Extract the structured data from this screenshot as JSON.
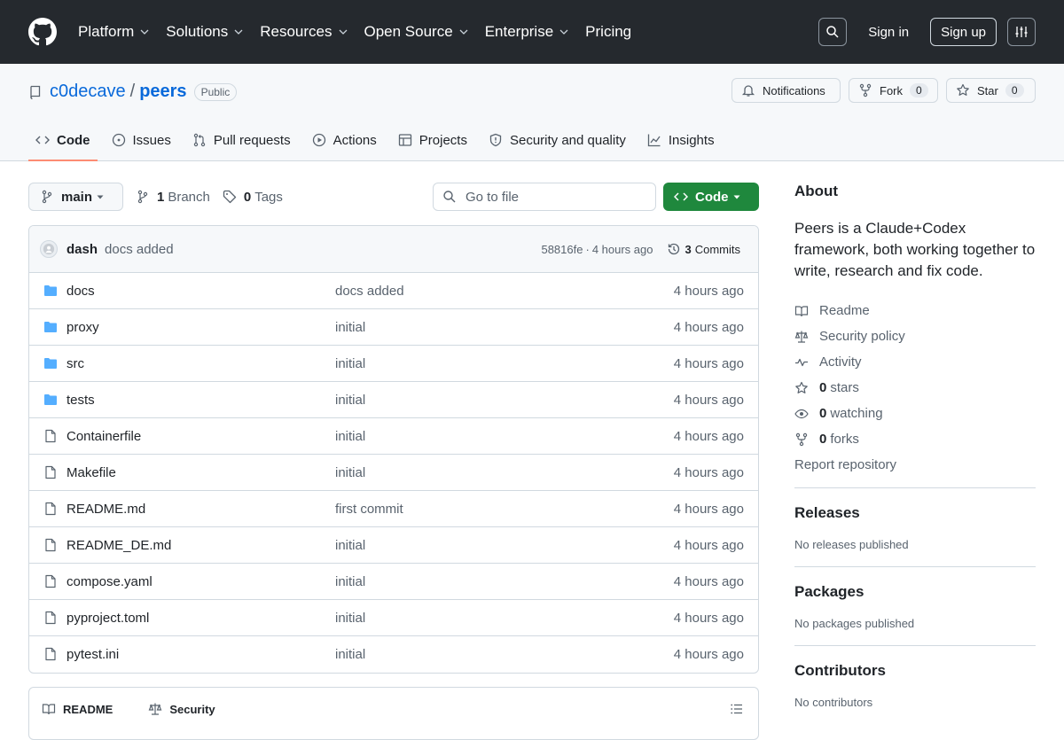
{
  "header": {
    "nav": [
      {
        "label": "Platform",
        "has_menu": true
      },
      {
        "label": "Solutions",
        "has_menu": true
      },
      {
        "label": "Resources",
        "has_menu": true
      },
      {
        "label": "Open Source",
        "has_menu": true
      },
      {
        "label": "Enterprise",
        "has_menu": true
      },
      {
        "label": "Pricing",
        "has_menu": false
      }
    ],
    "signin": "Sign in",
    "signup": "Sign up"
  },
  "repo": {
    "owner": "c0decave",
    "separator": "/",
    "name": "peers",
    "visibility": "Public",
    "notifications_label": "Notifications",
    "fork_label": "Fork",
    "fork_count": "0",
    "star_label": "Star",
    "star_count": "0"
  },
  "tabs": [
    {
      "label": "Code",
      "icon": "code-icon",
      "selected": true
    },
    {
      "label": "Issues",
      "icon": "issue-icon"
    },
    {
      "label": "Pull requests",
      "icon": "pull-request-icon"
    },
    {
      "label": "Actions",
      "icon": "play-icon"
    },
    {
      "label": "Projects",
      "icon": "table-icon"
    },
    {
      "label": "Security and quality",
      "icon": "shield-icon"
    },
    {
      "label": "Insights",
      "icon": "graph-icon"
    }
  ],
  "toolbar": {
    "branch": "main",
    "branch_count": "1",
    "branch_word": "Branch",
    "tag_count": "0",
    "tag_word": "Tags",
    "goto_placeholder": "Go to file",
    "code_button": "Code"
  },
  "commit": {
    "author": "dash",
    "message": "docs added",
    "hash": "58816fe",
    "sep": "·",
    "age": "4 hours ago",
    "count": "3",
    "count_word": "Commits"
  },
  "files": [
    {
      "name": "docs",
      "type": "dir",
      "message": "docs added",
      "age": "4 hours ago"
    },
    {
      "name": "proxy",
      "type": "dir",
      "message": "initial",
      "age": "4 hours ago"
    },
    {
      "name": "src",
      "type": "dir",
      "message": "initial",
      "age": "4 hours ago"
    },
    {
      "name": "tests",
      "type": "dir",
      "message": "initial",
      "age": "4 hours ago"
    },
    {
      "name": "Containerfile",
      "type": "file",
      "message": "initial",
      "age": "4 hours ago"
    },
    {
      "name": "Makefile",
      "type": "file",
      "message": "initial",
      "age": "4 hours ago"
    },
    {
      "name": "README.md",
      "type": "file",
      "message": "first commit",
      "age": "4 hours ago"
    },
    {
      "name": "README_DE.md",
      "type": "file",
      "message": "initial",
      "age": "4 hours ago"
    },
    {
      "name": "compose.yaml",
      "type": "file",
      "message": "initial",
      "age": "4 hours ago"
    },
    {
      "name": "pyproject.toml",
      "type": "file",
      "message": "initial",
      "age": "4 hours ago"
    },
    {
      "name": "pytest.ini",
      "type": "file",
      "message": "initial",
      "age": "4 hours ago"
    }
  ],
  "readme_tabs": [
    "README",
    "Security"
  ],
  "sidebar": {
    "about_title": "About",
    "about_text": "Peers is a Claude+Codex framework, both working together to write, research and fix code.",
    "links": [
      {
        "icon": "book-icon",
        "label": "Readme"
      },
      {
        "icon": "law-icon",
        "label": "Security policy"
      },
      {
        "icon": "pulse-icon",
        "label": "Activity"
      },
      {
        "icon": "star-icon",
        "count": "0",
        "label": "stars"
      },
      {
        "icon": "eye-icon",
        "count": "0",
        "label": "watching"
      },
      {
        "icon": "fork-icon",
        "count": "0",
        "label": "forks"
      }
    ],
    "report": "Report repository",
    "releases_title": "Releases",
    "releases_empty": "No releases published",
    "packages_title": "Packages",
    "packages_empty": "No packages published",
    "contributors_title": "Contributors",
    "contributors_empty": "No contributors"
  },
  "colors": {
    "header_bg": "#25292e",
    "link": "#0969da",
    "code_button": "#1f883d",
    "folder": "#54aeff",
    "tab_underline": "#fd8c73"
  }
}
